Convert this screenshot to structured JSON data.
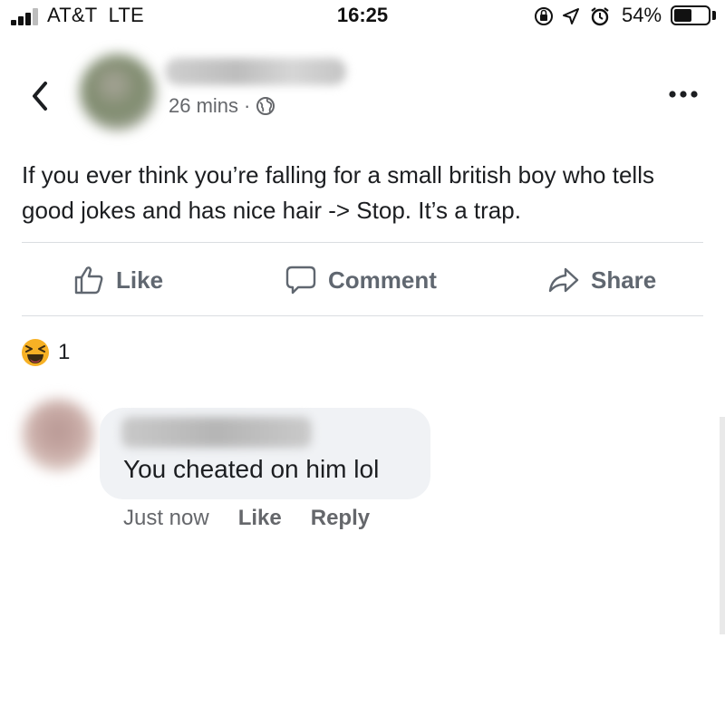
{
  "status_bar": {
    "carrier": "AT&T  LTE",
    "time": "16:25",
    "battery_percent": "54%",
    "battery_level": 0.54,
    "icons": [
      "orientation-lock-icon",
      "location-arrow-icon",
      "alarm-icon"
    ]
  },
  "post": {
    "timestamp": "26 mins",
    "separator": "·",
    "privacy_icon": "globe-icon",
    "text": "If you ever think you’re falling for a small british boy who tells good jokes and has nice hair -> Stop. It’s a trap."
  },
  "actions": {
    "like_label": "Like",
    "comment_label": "Comment",
    "share_label": "Share"
  },
  "reactions": {
    "icon": "laughing-emoji-icon",
    "count": "1"
  },
  "comment": {
    "text": "You cheated on him lol",
    "time": "Just now",
    "like_label": "Like",
    "reply_label": "Reply"
  }
}
